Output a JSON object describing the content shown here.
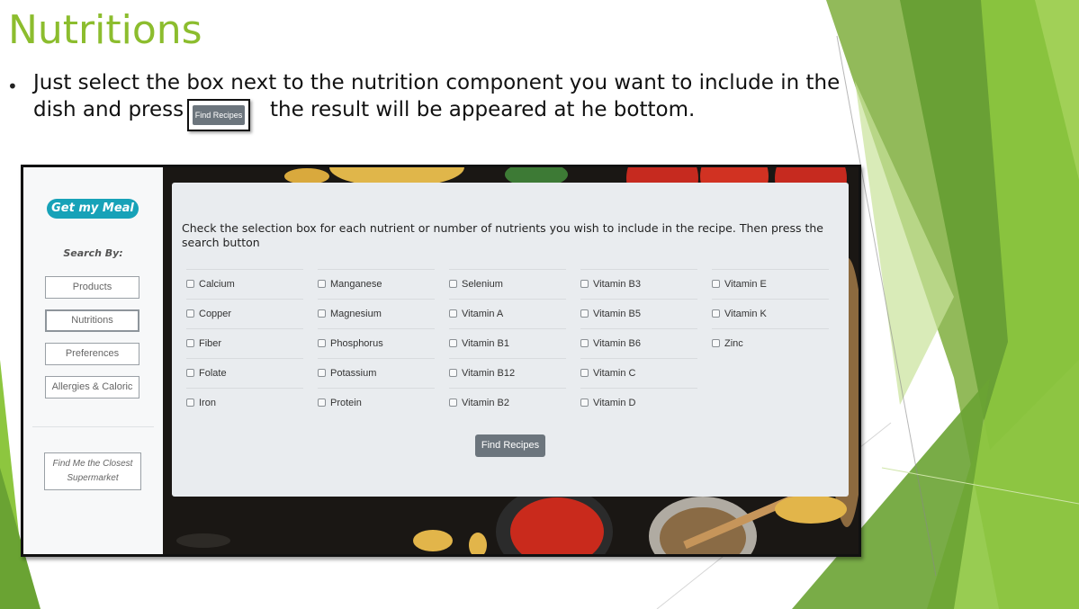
{
  "slide": {
    "title": "Nutritions",
    "bullet": "•",
    "line1": "Just select the box next to the nutrition component you want to include in the",
    "line2_before": "dish and press",
    "inline_button": "Find Recipes",
    "line2_after": "the result will be appeared at he bottom."
  },
  "app": {
    "brand": "Get my Meal",
    "search_by": "Search By:",
    "nav": [
      "Products",
      "Nutritions",
      "Preferences",
      "Allergies & Caloric"
    ],
    "active_nav": "Nutritions",
    "supermarket_line1": "Find Me the Closest",
    "supermarket_line2": "Supermarket",
    "instructions": "Check the selection box for each nutrient or number of nutrients you wish to include in the recipe. Then press the search button",
    "nutrient_columns": [
      [
        "Calcium",
        "Copper",
        "Fiber",
        "Folate",
        "Iron"
      ],
      [
        "Manganese",
        "Magnesium",
        "Phosphorus",
        "Potassium",
        "Protein"
      ],
      [
        "Selenium",
        "Vitamin A",
        "Vitamin B1",
        "Vitamin B12",
        "Vitamin B2"
      ],
      [
        "Vitamin B3",
        "Vitamin B5",
        "Vitamin B6",
        "Vitamin C",
        "Vitamin D"
      ],
      [
        "Vitamin E",
        "Vitamin K",
        "Zinc"
      ]
    ],
    "find_button": "Find Recipes"
  },
  "colors": {
    "title_green": "#8cbd2e",
    "brand_teal": "#17a2b8",
    "button_gray": "#6c757d",
    "panel_gray": "#e9ecef"
  }
}
